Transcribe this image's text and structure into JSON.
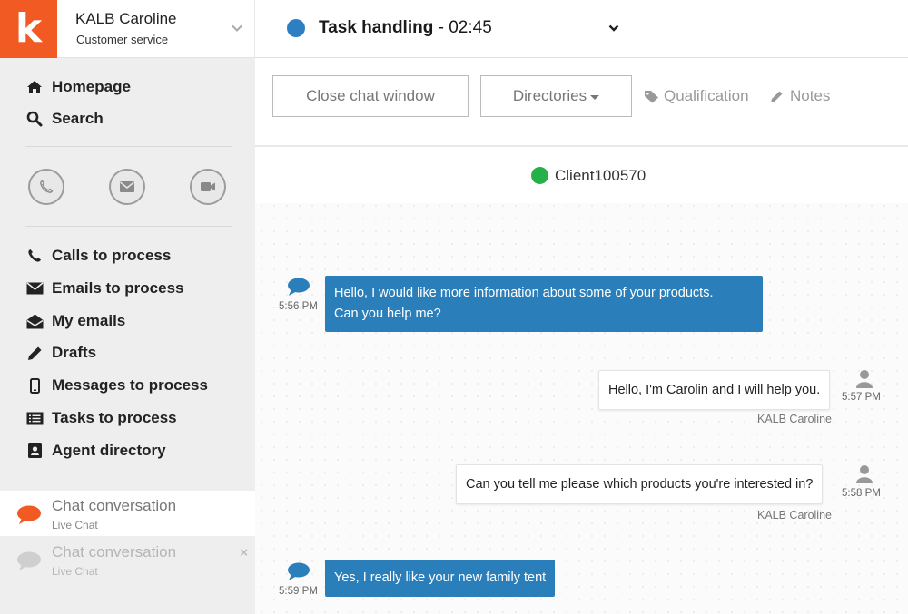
{
  "topbar": {
    "logo_letter": "k",
    "user_name": "KALB Caroline",
    "user_role": "Customer service",
    "task_label": "Task handling",
    "task_separator": " - ",
    "task_timer": "02:45",
    "task_status_color": "#2e7fc1"
  },
  "sidebar": {
    "nav_top": [
      {
        "label": "Homepage",
        "icon": "home-icon"
      },
      {
        "label": "Search",
        "icon": "search-icon"
      }
    ],
    "quick_actions": [
      "phone-icon",
      "envelope-icon",
      "video-camera-icon"
    ],
    "nav_items": [
      {
        "label": "Calls to process",
        "icon": "phone-icon"
      },
      {
        "label": "Emails to process",
        "icon": "envelope-icon"
      },
      {
        "label": "My emails",
        "icon": "envelope-open-icon"
      },
      {
        "label": "Drafts",
        "icon": "pencil-icon"
      },
      {
        "label": "Messages to process",
        "icon": "mobile-phone-icon"
      },
      {
        "label": "Tasks to process",
        "icon": "list-icon"
      },
      {
        "label": "Agent directory",
        "icon": "contact-card-icon"
      }
    ],
    "conversations": [
      {
        "title": "Chat conversation",
        "subtitle": "Live Chat",
        "active": true
      },
      {
        "title": "Chat conversation",
        "subtitle": "Live Chat",
        "active": false,
        "close": "×"
      }
    ]
  },
  "toolbar": {
    "close_chat": "Close chat window",
    "directories": "Directories",
    "qualification": "Qualification",
    "notes": "Notes"
  },
  "chat": {
    "client_name": "Client100570",
    "client_status_color": "#25b14a",
    "messages": [
      {
        "from": "client",
        "lines": [
          "Hello, I would like more information about some of your products.",
          "Can you help me?"
        ],
        "time": "5:56 PM"
      },
      {
        "from": "agent",
        "text": "Hello, I'm Carolin and I will help you.",
        "time": "5:57 PM",
        "sender": "KALB Caroline"
      },
      {
        "from": "agent",
        "text": "Can you tell me please which products you're interested in?",
        "time": "5:58 PM",
        "sender": "KALB Caroline"
      },
      {
        "from": "client",
        "lines": [
          "Yes, I really like your new family tent"
        ],
        "time": "5:59 PM"
      }
    ]
  },
  "colors": {
    "brand": "#f15a22",
    "client_bubble": "#2a7fba",
    "sidebar_bg": "#eeeeee"
  }
}
